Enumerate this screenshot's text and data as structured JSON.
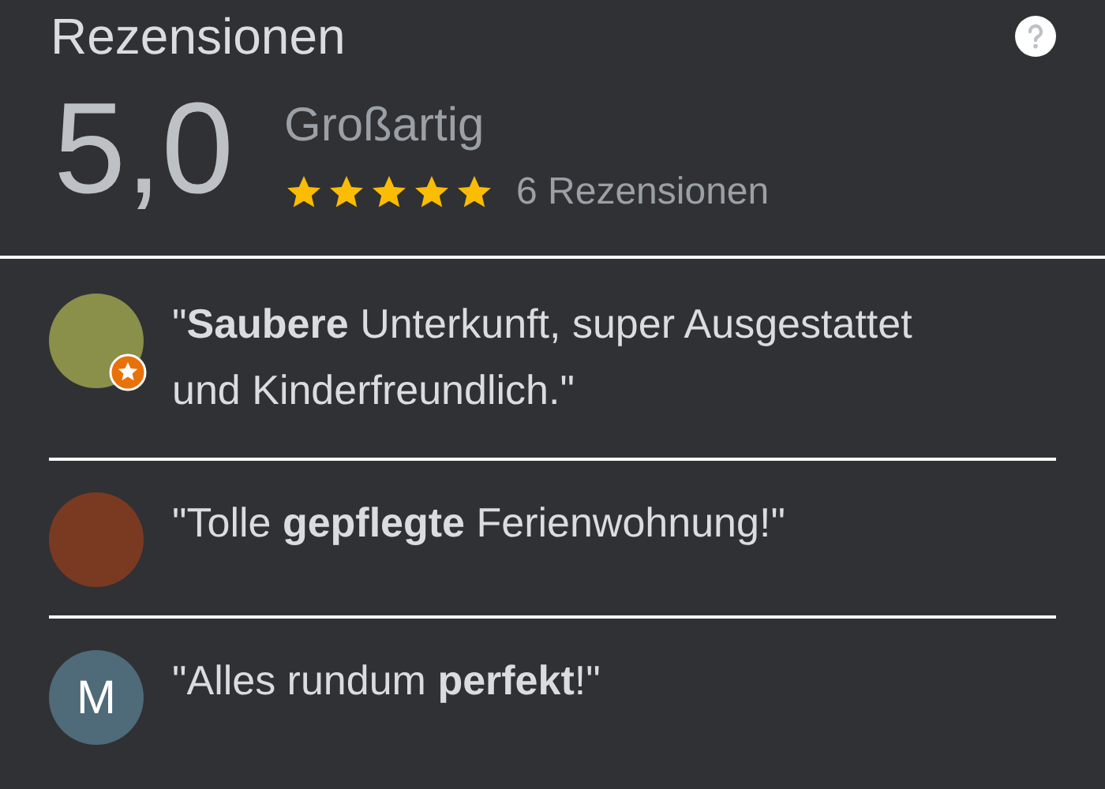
{
  "header": {
    "title": "Rezensionen"
  },
  "summary": {
    "score": "5,0",
    "label": "Großartig",
    "stars": 5,
    "count": "6 Rezensionen"
  },
  "reviews": [
    {
      "avatar": {
        "kind": "photo",
        "badge": true
      },
      "text": "\"**Saubere** Unterkunft, super Ausgestattet und Kinderfreundlich.\""
    },
    {
      "avatar": {
        "kind": "photo",
        "badge": false
      },
      "text": "\"Tolle **gepflegte** Ferienwohnung!\""
    },
    {
      "avatar": {
        "kind": "letter",
        "letter": "M",
        "badge": false
      },
      "text": "\"Alles rundum **perfekt**!\""
    }
  ]
}
